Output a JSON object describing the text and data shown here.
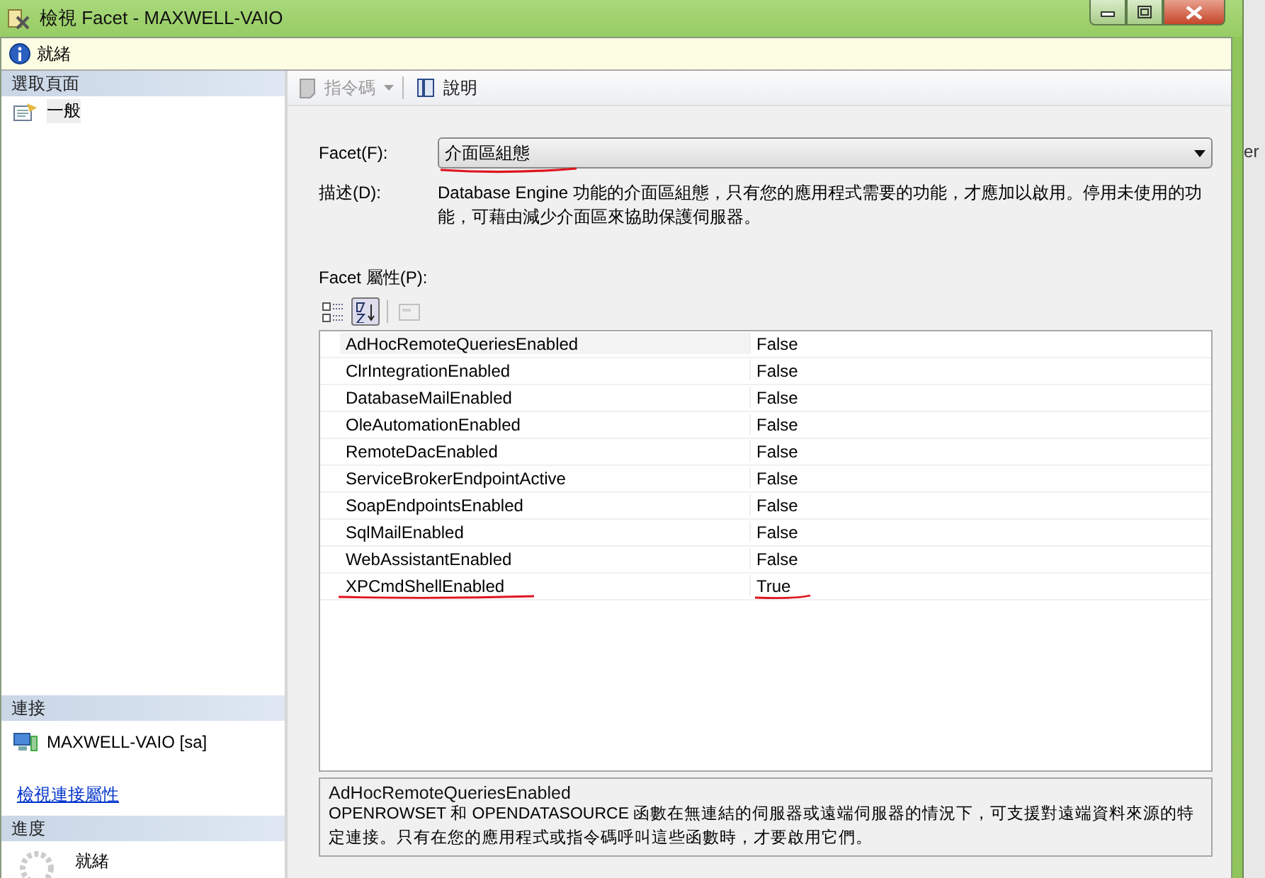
{
  "window": {
    "title": "檢視 Facet - MAXWELL-VAIO"
  },
  "status": {
    "text": "就緒"
  },
  "sidebar": {
    "header": "選取頁面",
    "items": [
      {
        "label": "一般",
        "selected": true
      }
    ]
  },
  "connection": {
    "header": "連接",
    "server": "MAXWELL-VAIO [sa]",
    "link": "檢視連接屬性"
  },
  "progress": {
    "header": "進度",
    "text": "就緒"
  },
  "toolbar": {
    "items": [
      {
        "kind": "script",
        "label": "指令碼",
        "disabled": true
      },
      {
        "kind": "help",
        "label": "說明",
        "disabled": false
      }
    ]
  },
  "facet": {
    "label": "Facet(F):",
    "value": "介面區組態",
    "marked": true
  },
  "description": {
    "label": "描述(D):",
    "text": "Database Engine 功能的介面區組態，只有您的應用程式需要的功能，才應加以啟用。停用未使用的功能，可藉由減少介面區來協助保護伺服器。"
  },
  "properties": {
    "label": "Facet 屬性(P):",
    "view_buttons": [
      {
        "kind": "categorized",
        "selected": false,
        "disabled": false
      },
      {
        "kind": "alphabetical",
        "selected": true,
        "disabled": false
      },
      {
        "kind": "pages",
        "selected": false,
        "disabled": true
      }
    ],
    "rows": [
      {
        "name": "AdHocRemoteQueriesEnabled",
        "value": "False",
        "selected": true,
        "marked": false
      },
      {
        "name": "ClrIntegrationEnabled",
        "value": "False",
        "selected": false,
        "marked": false
      },
      {
        "name": "DatabaseMailEnabled",
        "value": "False",
        "selected": false,
        "marked": false
      },
      {
        "name": "OleAutomationEnabled",
        "value": "False",
        "selected": false,
        "marked": false
      },
      {
        "name": "RemoteDacEnabled",
        "value": "False",
        "selected": false,
        "marked": false
      },
      {
        "name": "ServiceBrokerEndpointActive",
        "value": "False",
        "selected": false,
        "marked": false
      },
      {
        "name": "SoapEndpointsEnabled",
        "value": "False",
        "selected": false,
        "marked": false
      },
      {
        "name": "SqlMailEnabled",
        "value": "False",
        "selected": false,
        "marked": false
      },
      {
        "name": "WebAssistantEnabled",
        "value": "False",
        "selected": false,
        "marked": false
      },
      {
        "name": "XPCmdShellEnabled",
        "value": "True",
        "selected": false,
        "marked": true
      }
    ]
  },
  "help": {
    "title": "AdHocRemoteQueriesEnabled",
    "text": "OPENROWSET 和 OPENDATASOURCE 函數在無連結的伺服器或遠端伺服器的情況下，可支援對遠端資料來源的特定連接。只有在您的應用程式或指令碼呼叫這些函數時，才要啟用它們。"
  },
  "background_fragment": "er"
}
